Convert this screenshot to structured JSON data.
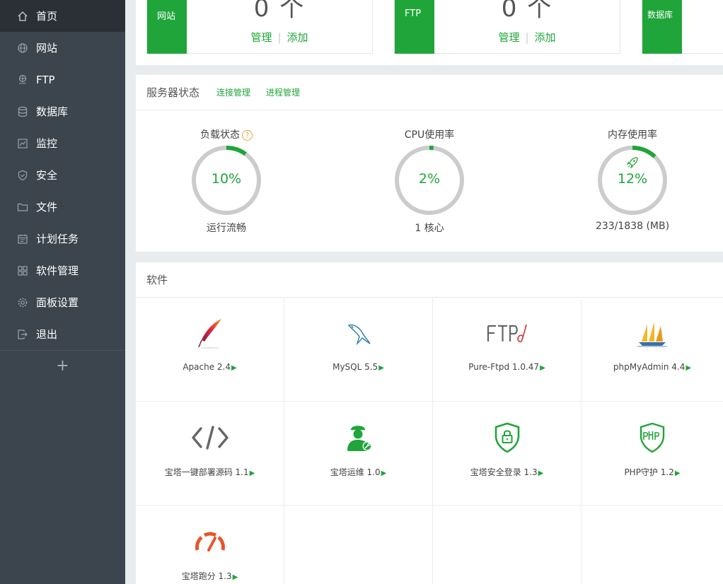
{
  "sidebar": {
    "items": [
      {
        "label": "首页",
        "icon": "home-icon",
        "active": true
      },
      {
        "label": "网站",
        "icon": "globe-icon"
      },
      {
        "label": "FTP",
        "icon": "ftp-icon"
      },
      {
        "label": "数据库",
        "icon": "database-icon"
      },
      {
        "label": "监控",
        "icon": "monitor-icon"
      },
      {
        "label": "安全",
        "icon": "shield-icon"
      },
      {
        "label": "文件",
        "icon": "folder-icon"
      },
      {
        "label": "计划任务",
        "icon": "calendar-icon"
      },
      {
        "label": "软件管理",
        "icon": "grid-icon"
      },
      {
        "label": "面板设置",
        "icon": "gear-icon"
      },
      {
        "label": "退出",
        "icon": "logout-icon"
      }
    ],
    "add_label": "+"
  },
  "stats": [
    {
      "tag": "网站",
      "count": "0 个",
      "manage": "管理",
      "add": "添加"
    },
    {
      "tag": "FTP",
      "count": "0 个",
      "manage": "管理",
      "add": "添加"
    },
    {
      "tag": "数据库"
    }
  ],
  "status": {
    "title": "服务器状态",
    "link_conn": "连接管理",
    "link_proc": "进程管理",
    "load": {
      "title": "负载状态",
      "value": "10%",
      "percent": 10,
      "sub": "运行流畅",
      "help": "?"
    },
    "cpu": {
      "title": "CPU使用率",
      "value": "2%",
      "percent": 2,
      "sub": "1 核心"
    },
    "mem": {
      "title": "内存使用率",
      "value": "12%",
      "percent": 12,
      "sub": "233/1838 (MB)"
    }
  },
  "software": {
    "title": "软件",
    "items": [
      {
        "name": "Apache 2.4",
        "icon": "apache-feather-icon"
      },
      {
        "name": "MySQL 5.5",
        "icon": "mysql-dolphin-icon"
      },
      {
        "name": "Pure-Ftpd 1.0.47",
        "icon": "ftpd-logo-icon"
      },
      {
        "name": "phpMyAdmin 4.4",
        "icon": "phpmyadmin-sailboat-icon"
      },
      {
        "name": "宝塔一键部署源码 1.1",
        "icon": "code-icon"
      },
      {
        "name": "宝塔运维 1.0",
        "icon": "ops-worker-icon"
      },
      {
        "name": "宝塔安全登录 1.3",
        "icon": "shield-lock-icon"
      },
      {
        "name": "PHP守护 1.2",
        "icon": "php-shield-icon"
      },
      {
        "name": "宝塔跑分 1.3",
        "icon": "speedometer-icon"
      }
    ],
    "arrow": "▶"
  },
  "colors": {
    "accent": "#20a53a",
    "sidebar": "#3c444d",
    "sidebar_active": "#2b3036",
    "ring": "#cccccc"
  }
}
